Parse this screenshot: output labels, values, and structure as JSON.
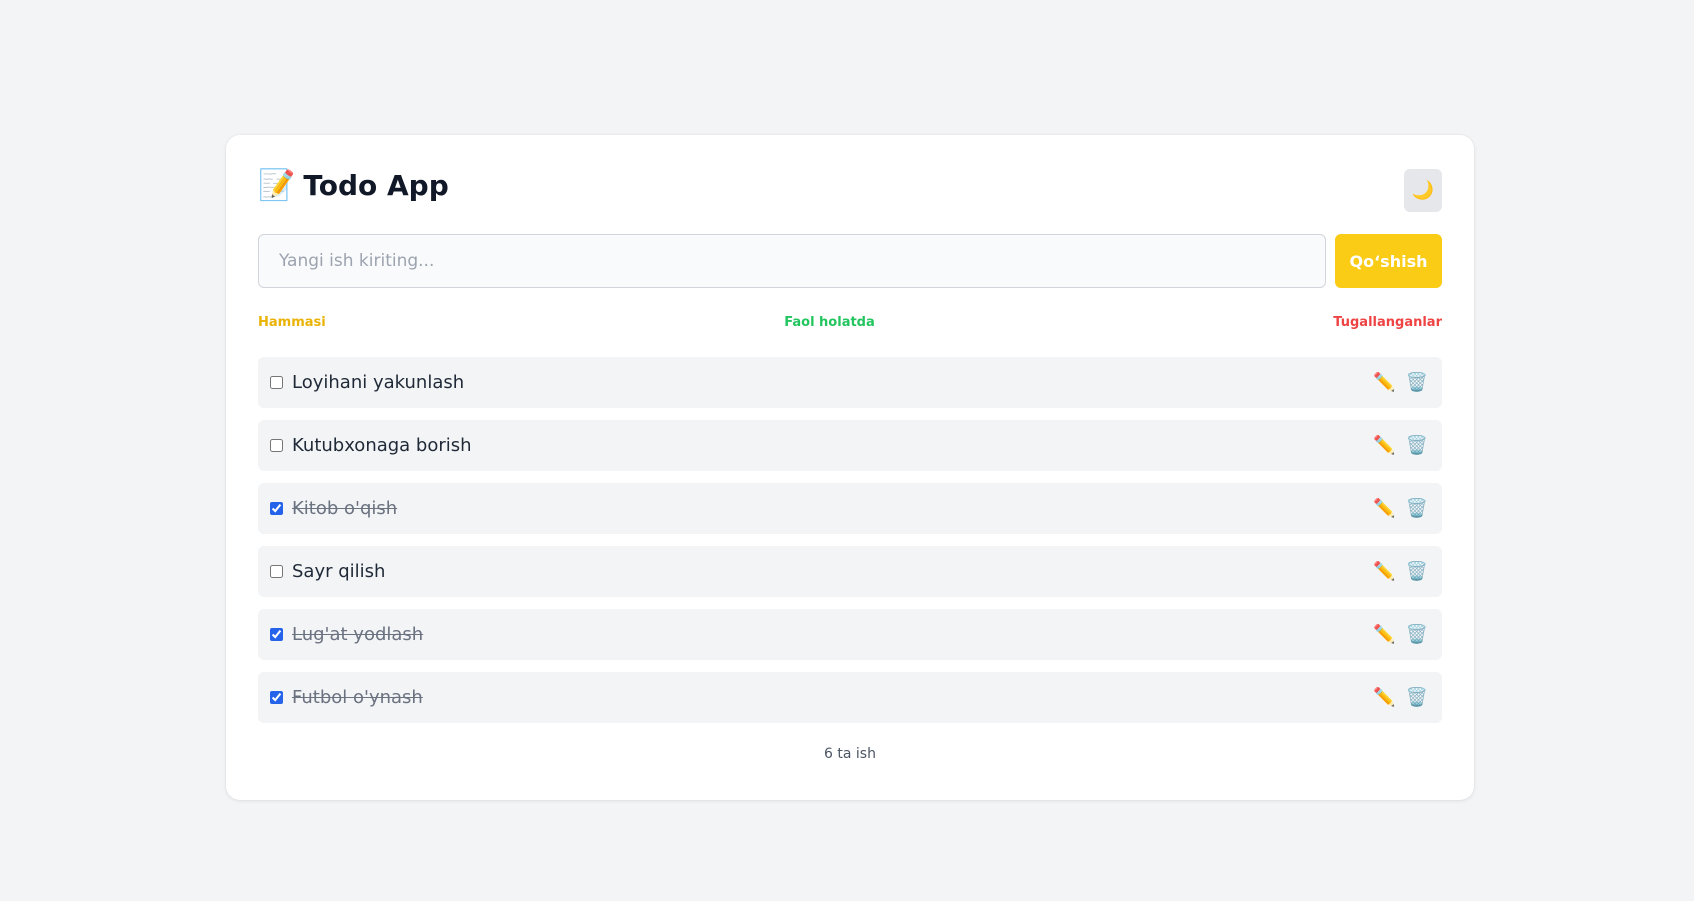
{
  "app": {
    "title": "Todo App",
    "title_icon": "📝",
    "theme_icon": "🌙"
  },
  "input": {
    "placeholder": "Yangi ish kiriting...",
    "value": ""
  },
  "add_button": {
    "label": "Qo‘shish",
    "color": "#facc15"
  },
  "filters": [
    {
      "label": "Hammasi",
      "color": "#eab308"
    },
    {
      "label": "Faol holatda",
      "color": "#22c55e"
    },
    {
      "label": "Tugallanganlar",
      "color": "#ef4444"
    }
  ],
  "todos": [
    {
      "text": "Loyihani yakunlash",
      "done": false,
      "edit_icon": "✏️",
      "delete_icon": "🗑️"
    },
    {
      "text": "Kutubxonaga borish",
      "done": false,
      "edit_icon": "✏️",
      "delete_icon": "🗑️"
    },
    {
      "text": "Kitob o'qish",
      "done": true,
      "edit_icon": "✏️",
      "delete_icon": "🗑️"
    },
    {
      "text": "Sayr qilish",
      "done": false,
      "edit_icon": "✏️",
      "delete_icon": "🗑️"
    },
    {
      "text": "Lug'at yodlash",
      "done": true,
      "edit_icon": "✏️",
      "delete_icon": "🗑️"
    },
    {
      "text": "Futbol o'ynash",
      "done": true,
      "edit_icon": "✏️",
      "delete_icon": "🗑️"
    }
  ],
  "footer": {
    "count_text": "6 ta ish"
  }
}
